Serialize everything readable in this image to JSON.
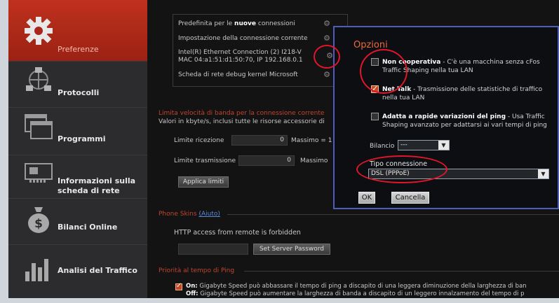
{
  "sidebar": {
    "items": [
      {
        "label": "Preferenze",
        "icon": "gear-icon",
        "active": true
      },
      {
        "label": "Protocolli",
        "icon": "network-icon"
      },
      {
        "label": "Programmi",
        "icon": "windows-icon"
      },
      {
        "label": "Informazioni sulla scheda di rete",
        "line1": "Informazioni sulla",
        "line2": "scheda di rete",
        "icon": "network-card-icon"
      },
      {
        "label": "Bilanci Online",
        "icon": "money-bag-icon"
      },
      {
        "label": "Analisi del Traffico",
        "icon": "bar-chart-icon"
      }
    ]
  },
  "main": {
    "connections": [
      "Predefinita per le nuove connessioni",
      "Impostazione della connessione corrente",
      "Intel(R) Ethernet Connection (2) I218-V",
      "MAC 04:a1:51:d1:50:70, IP 192.168.0.1",
      "Scheda di rete debug kernel Microsoft"
    ],
    "connections_first_prefix": "Predefinita per le ",
    "connections_first_bold": "nuove",
    "connections_first_suffix": " connessioni",
    "bandwidth": {
      "title": "Limita velocità di banda per la connessione corrente",
      "subtitle": "Valori in kbyte/s, inclusi tutte le risorse accessorie di",
      "rx_label": "Limite ricezione",
      "rx_value": "0",
      "rx_max_label": "Massimo = 1",
      "tx_label": "Limite trasmissione",
      "tx_value": "0",
      "tx_max_label": "Massimo",
      "apply_button": "Applica limiti"
    },
    "phone_skins": {
      "title": "Phone Skins",
      "help": "(Aiuto)",
      "access_text": "HTTP access from remote is forbidden",
      "password_button": "Set Server Password"
    },
    "ping": {
      "title": "Priorità al tempo di Ping",
      "on_label": "On:",
      "on_text": "Gigabyte Speed può abbassare il tempo di ping a discapito di una leggera diminuzione della larghezza di ban",
      "off_label": "Off:",
      "off_text": "Gigabyte Speed può aumentare la larghezza di banda a discapito di un leggero innalzamento del tempo di p"
    }
  },
  "dialog": {
    "title": "Opzioni",
    "options": [
      {
        "bold": "Non cooperativa",
        "text": " - C'è una macchina senza cFos Traffic Shaping nella tua LAN",
        "line1": " - C'è una macchina senza cFos",
        "line2": "Traffic Shaping nella tua LAN",
        "checked": false
      },
      {
        "bold": "Net Talk",
        "text": " - Trasmissione delle statistiche di traffico nella tua LAN",
        "line1": " - Trasmissione delle statistiche di traffico",
        "line2": "nella tua LAN",
        "checked": true
      },
      {
        "bold": "Adatta a rapide variazioni del ping",
        "text": " - Usa Traffic Shaping avanzato per adattarsi ai vari tempi di ping",
        "line1": " - Usa Traffic",
        "line2": "Shaping avanzato per adattarsi ai vari tempi di ping",
        "checked": false
      }
    ],
    "balance_label": "Bilancio",
    "balance_value": "---",
    "conn_type_label": "Tipo connessione",
    "conn_type_value": "DSL (PPPoE)",
    "ok_button": "OK",
    "cancel_button": "Cancella"
  },
  "colors": {
    "accent": "#c0311d",
    "highlight_ring": "#e0162b",
    "dialog_border": "#4f5db9",
    "dialog_title": "#ea6a3d"
  }
}
